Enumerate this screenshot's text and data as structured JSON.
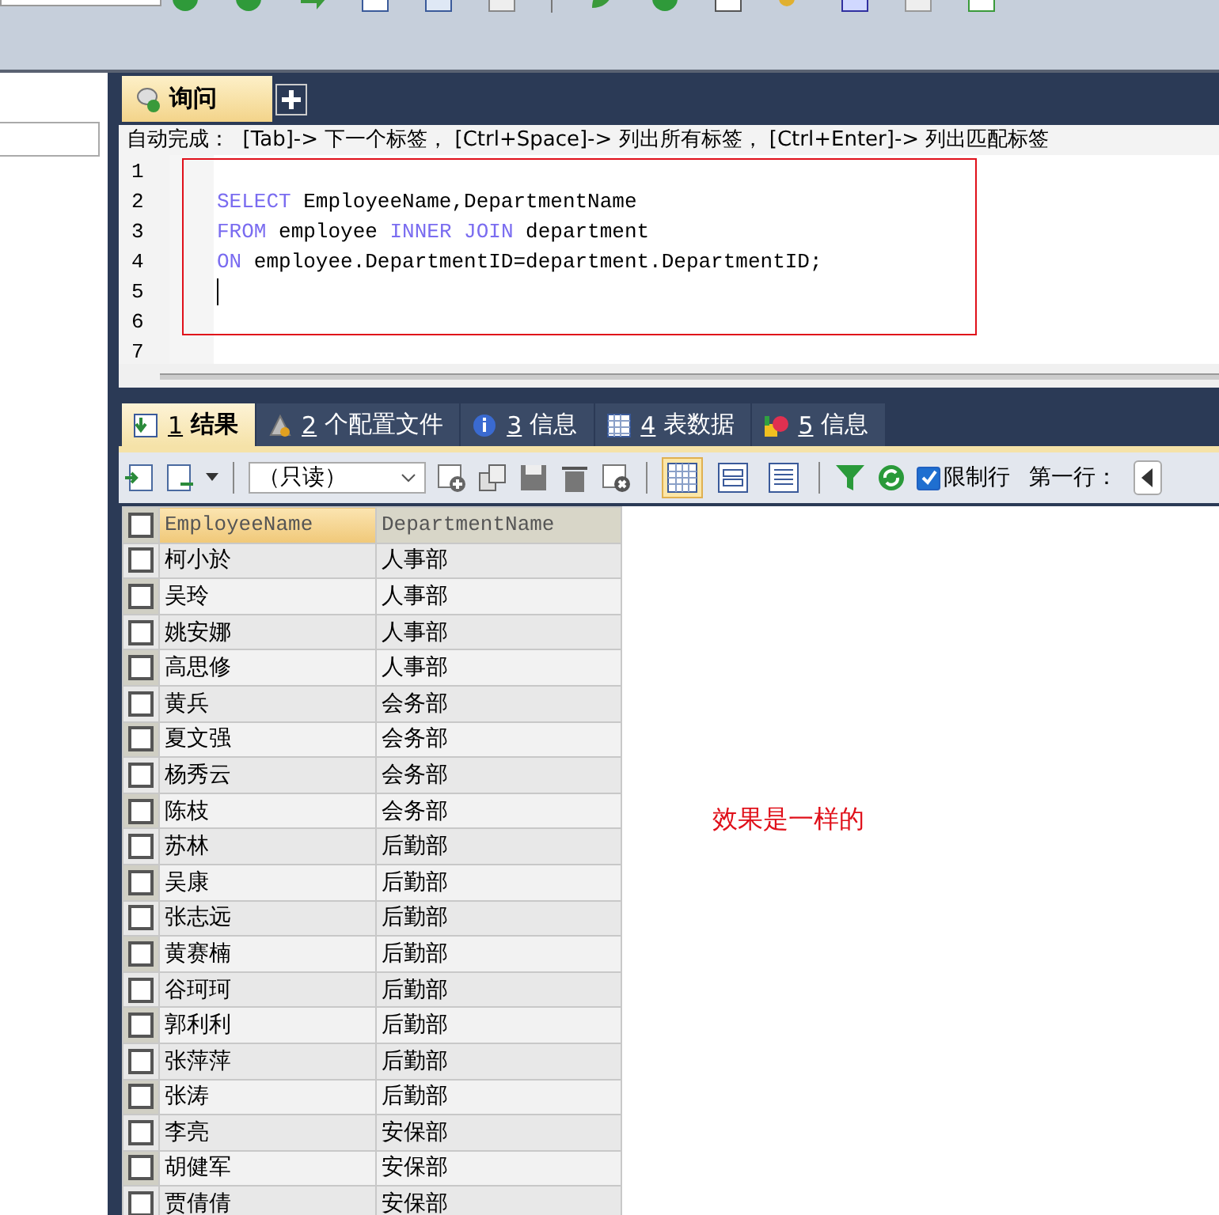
{
  "query_tabs": [
    {
      "label": "询问",
      "selected": true
    }
  ],
  "autocomplete_hint": "自动完成：  [Tab]-> 下一个标签， [Ctrl+Space]-> 列出所有标签， [Ctrl+Enter]-> 列出匹配标签",
  "editor": {
    "line_numbers": [
      "1",
      "2",
      "3",
      "4",
      "5",
      "6",
      "7"
    ],
    "lines": [
      {
        "tokens": [
          {
            "kind": "keyword",
            "text": "SELECT"
          },
          {
            "kind": "plain",
            "text": " EmployeeName,DepartmentName"
          }
        ]
      },
      {
        "tokens": [
          {
            "kind": "keyword",
            "text": "FROM"
          },
          {
            "kind": "plain",
            "text": " employee "
          },
          {
            "kind": "keyword",
            "text": "INNER JOIN"
          },
          {
            "kind": "plain",
            "text": " department"
          }
        ]
      },
      {
        "tokens": [
          {
            "kind": "keyword",
            "text": "ON"
          },
          {
            "kind": "plain",
            "text": " employee.DepartmentID=department.DepartmentID;"
          }
        ]
      }
    ],
    "cursor": true,
    "highlight_frame": true
  },
  "result_tabs": [
    {
      "key": "1",
      "label": "结果",
      "selected": true,
      "kind": "result"
    },
    {
      "key": "2",
      "label": "个配置文件",
      "selected": false,
      "kind": "profile"
    },
    {
      "key": "3",
      "label": "信息",
      "selected": false,
      "kind": "info"
    },
    {
      "key": "4",
      "label": "表数据",
      "selected": false,
      "kind": "table"
    },
    {
      "key": "5",
      "label": "信息",
      "selected": false,
      "kind": "shapes"
    }
  ],
  "result_toolbar": {
    "mode_dropdown": "（只读）",
    "view_modes": [
      {
        "kind": "grid",
        "selected": true
      },
      {
        "kind": "form",
        "selected": false
      },
      {
        "kind": "text",
        "selected": false
      }
    ],
    "limit_rows": {
      "label": "限制行",
      "checked": true
    },
    "first_row_label": "第一行："
  },
  "grid": {
    "all_checked": false,
    "columns": [
      {
        "label": "EmployeeName",
        "selected": true
      },
      {
        "label": "DepartmentName",
        "selected": false
      }
    ],
    "rows": [
      {
        "checked": false,
        "cells": [
          "柯小於",
          "人事部"
        ]
      },
      {
        "checked": false,
        "cells": [
          "吴玲",
          "人事部"
        ]
      },
      {
        "checked": false,
        "cells": [
          "姚安娜",
          "人事部"
        ]
      },
      {
        "checked": false,
        "cells": [
          "高思修",
          "人事部"
        ]
      },
      {
        "checked": false,
        "cells": [
          "黄兵",
          "会务部"
        ]
      },
      {
        "checked": false,
        "cells": [
          "夏文强",
          "会务部"
        ]
      },
      {
        "checked": false,
        "cells": [
          "杨秀云",
          "会务部"
        ]
      },
      {
        "checked": false,
        "cells": [
          "陈枝",
          "会务部"
        ]
      },
      {
        "checked": false,
        "cells": [
          "苏林",
          "后勤部"
        ]
      },
      {
        "checked": false,
        "cells": [
          "吴康",
          "后勤部"
        ]
      },
      {
        "checked": false,
        "cells": [
          "张志远",
          "后勤部"
        ]
      },
      {
        "checked": false,
        "cells": [
          "黄赛楠",
          "后勤部"
        ]
      },
      {
        "checked": false,
        "cells": [
          "谷珂珂",
          "后勤部"
        ]
      },
      {
        "checked": false,
        "cells": [
          "郭利利",
          "后勤部"
        ]
      },
      {
        "checked": false,
        "cells": [
          "张萍萍",
          "后勤部"
        ]
      },
      {
        "checked": false,
        "cells": [
          "张涛",
          "后勤部"
        ]
      },
      {
        "checked": false,
        "cells": [
          "李亮",
          "安保部"
        ]
      },
      {
        "checked": false,
        "cells": [
          "胡健军",
          "安保部"
        ]
      },
      {
        "checked": false,
        "cells": [
          "贾倩倩",
          "安保部"
        ]
      }
    ]
  },
  "note": "效果是一样的"
}
